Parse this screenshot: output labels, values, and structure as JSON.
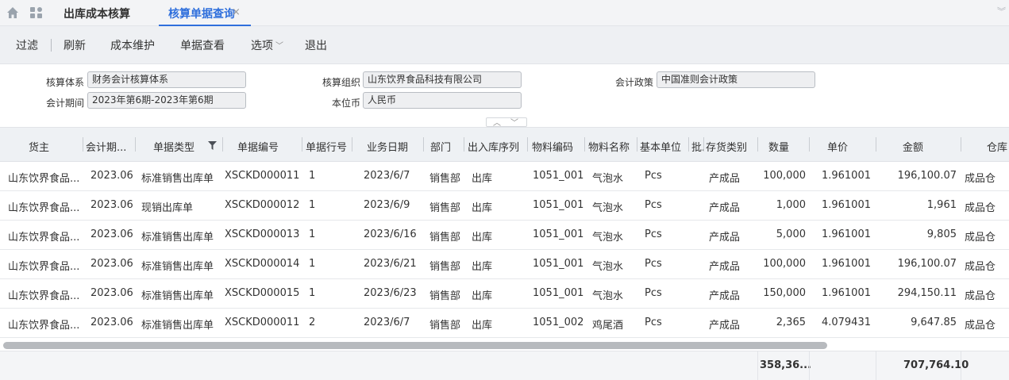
{
  "tabs": {
    "first_label": "出库成本核算",
    "active_label": "核算单据查询",
    "close_glyph": "×"
  },
  "toolbar": {
    "filter": "过滤",
    "refresh": "刷新",
    "cost_maintain": "成本维护",
    "doc_view": "单据查看",
    "options": "选项",
    "exit": "退出"
  },
  "form": {
    "system_label": "核算体系",
    "system_value": "财务会计核算体系",
    "org_label": "核算组织",
    "org_value": "山东饮界食品科技有限公司",
    "policy_label": "会计政策",
    "policy_value": "中国准则会计政策",
    "period_label": "会计期间",
    "period_value": "2023年第6期-2023年第6期",
    "currency_label": "本位币",
    "currency_value": "人民币"
  },
  "table": {
    "headers": [
      "货主",
      "会计期...",
      "单据类型",
      "单据编号",
      "单据行号",
      "业务日期",
      "部门",
      "出入库序列",
      "物料编码",
      "物料名称",
      "基本单位",
      "批.",
      "存货类别",
      "数量",
      "单价",
      "金额",
      "仓库"
    ],
    "rows": [
      [
        "山东饮界食品...",
        "2023.06",
        "标准销售出库单",
        "XSCKD000011",
        "1",
        "2023/6/7",
        "销售部",
        "出库",
        "1051_001",
        "气泡水",
        "Pcs",
        "",
        "产成品",
        "100,000",
        "1.961001",
        "196,100.07",
        "成品仓"
      ],
      [
        "山东饮界食品...",
        "2023.06",
        "现销出库单",
        "XSCKD000012",
        "1",
        "2023/6/9",
        "销售部",
        "出库",
        "1051_001",
        "气泡水",
        "Pcs",
        "",
        "产成品",
        "1,000",
        "1.961001",
        "1,961",
        "成品仓"
      ],
      [
        "山东饮界食品...",
        "2023.06",
        "标准销售出库单",
        "XSCKD000013",
        "1",
        "2023/6/16",
        "销售部",
        "出库",
        "1051_001",
        "气泡水",
        "Pcs",
        "",
        "产成品",
        "5,000",
        "1.961001",
        "9,805",
        "成品仓"
      ],
      [
        "山东饮界食品...",
        "2023.06",
        "标准销售出库单",
        "XSCKD000014",
        "1",
        "2023/6/21",
        "销售部",
        "出库",
        "1051_001",
        "气泡水",
        "Pcs",
        "",
        "产成品",
        "100,000",
        "1.961001",
        "196,100.07",
        "成品仓"
      ],
      [
        "山东饮界食品...",
        "2023.06",
        "标准销售出库单",
        "XSCKD000015",
        "1",
        "2023/6/23",
        "销售部",
        "出库",
        "1051_001",
        "气泡水",
        "Pcs",
        "",
        "产成品",
        "150,000",
        "1.961001",
        "294,150.11",
        "成品仓"
      ],
      [
        "山东饮界食品...",
        "2023.06",
        "标准销售出库单",
        "XSCKD000011",
        "2",
        "2023/6/7",
        "销售部",
        "出库",
        "1051_002",
        "鸡尾酒",
        "Pcs",
        "",
        "产成品",
        "2,365",
        "4.079431",
        "9,647.85",
        "成品仓"
      ]
    ]
  },
  "footer": {
    "qty_total": "358,36...",
    "amount_total": "707,764.10"
  },
  "icons": {
    "home": "home-icon",
    "apps": "apps-grid-icon",
    "filter": "filter-funnel-icon"
  },
  "colors": {
    "accent": "#2f6fdc"
  }
}
